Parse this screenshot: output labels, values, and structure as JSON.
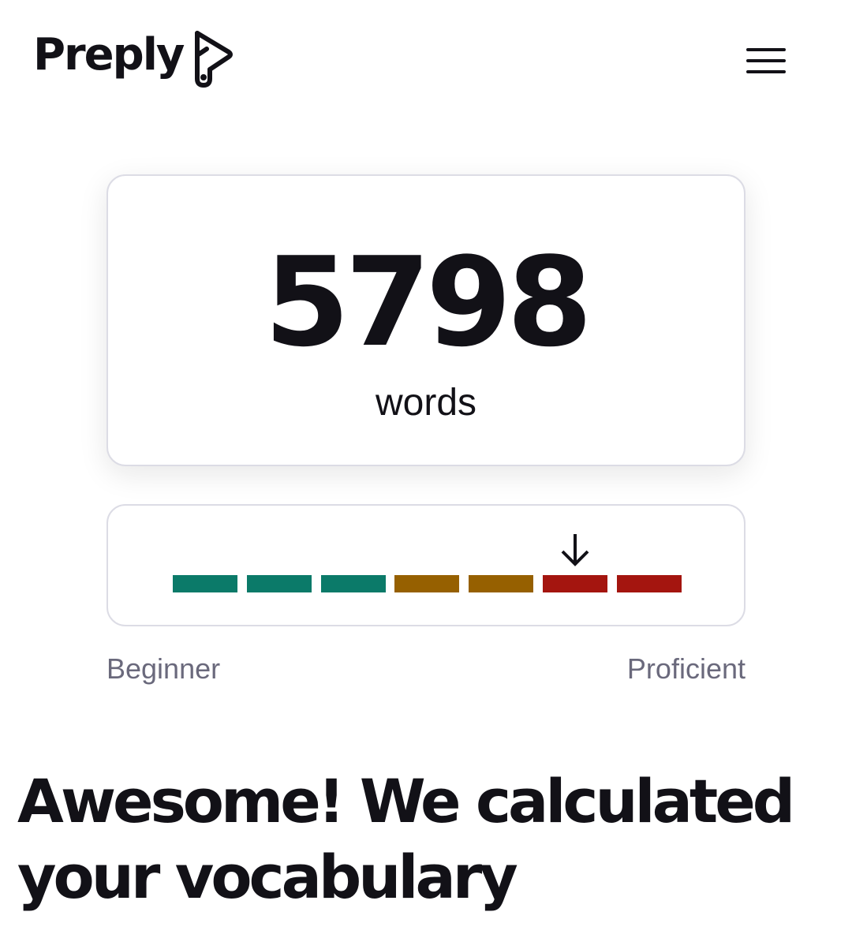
{
  "header": {
    "brand": "Preply",
    "logo_icon": "preply-mark-icon",
    "menu_icon": "hamburger-menu-icon"
  },
  "result": {
    "word_count": "5798",
    "unit": "words"
  },
  "level": {
    "segment_colors": [
      "#0b7a69",
      "#0b7a69",
      "#0b7a69",
      "#966000",
      "#966000",
      "#a4150f",
      "#a4150f"
    ],
    "marker_segment": 5,
    "marker_icon": "arrow-down-icon",
    "scale_start_label": "Beginner",
    "scale_end_label": "Proficient"
  },
  "headline": "Awesome! We calculated your vocabulary"
}
